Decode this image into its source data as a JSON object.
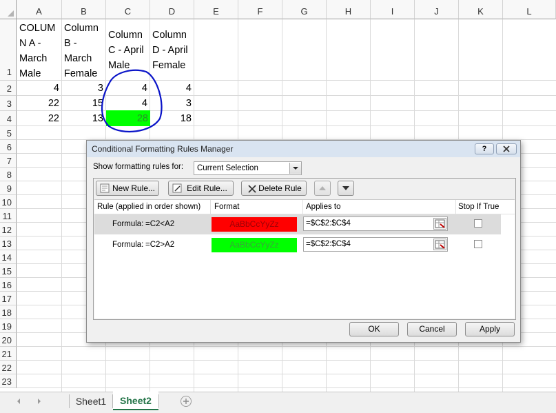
{
  "columns": [
    "A",
    "B",
    "C",
    "D",
    "E",
    "F",
    "G",
    "H",
    "I",
    "J",
    "K",
    "L"
  ],
  "rows": [
    "1",
    "2",
    "3",
    "4",
    "5",
    "6",
    "7",
    "8",
    "9",
    "10",
    "11",
    "12",
    "13",
    "14",
    "15",
    "16",
    "17",
    "18",
    "19",
    "20",
    "21",
    "22",
    "23"
  ],
  "headers": {
    "a": "COLUM\nN A -\nMarch\nMale",
    "b": "Column\nB -\nMarch\nFemale",
    "c": "Column\nC - April\nMale",
    "d": "Column\nD - April\nFemale"
  },
  "data": [
    [
      "4",
      "3",
      "4",
      "4"
    ],
    [
      "22",
      "15",
      "4",
      "3"
    ],
    [
      "22",
      "13",
      "28",
      "18"
    ]
  ],
  "tabs": {
    "sheet1": "Sheet1",
    "sheet2": "Sheet2"
  },
  "dialog": {
    "title": "Conditional Formatting Rules Manager",
    "help": "?",
    "show_label": "Show formatting rules for:",
    "show_value": "Current Selection",
    "new_rule": "New Rule...",
    "edit_rule": "Edit Rule...",
    "delete_rule": "Delete Rule",
    "col_rule": "Rule (applied in order shown)",
    "col_format": "Format",
    "col_applies": "Applies to",
    "col_stop": "Stop If True",
    "rules": [
      {
        "label": "Formula:",
        "formula": "=C2<A2",
        "preview": "AaBbCcYyZz",
        "applies": "=$C$2:$C$4",
        "fill": "#ff0000",
        "text_color": "#9c0006"
      },
      {
        "label": "Formula:",
        "formula": "=C2>A2",
        "preview": "AaBbCcYyZz",
        "applies": "=$C$2:$C$4",
        "fill": "#00ff00",
        "text_color": "#3aa33a"
      }
    ],
    "ok": "OK",
    "cancel": "Cancel",
    "apply": "Apply"
  },
  "colors": {
    "green_fill": "#00ff00",
    "red_fill": "#ff0000",
    "annotation": "#0a14c8",
    "active_tab": "#217346"
  }
}
